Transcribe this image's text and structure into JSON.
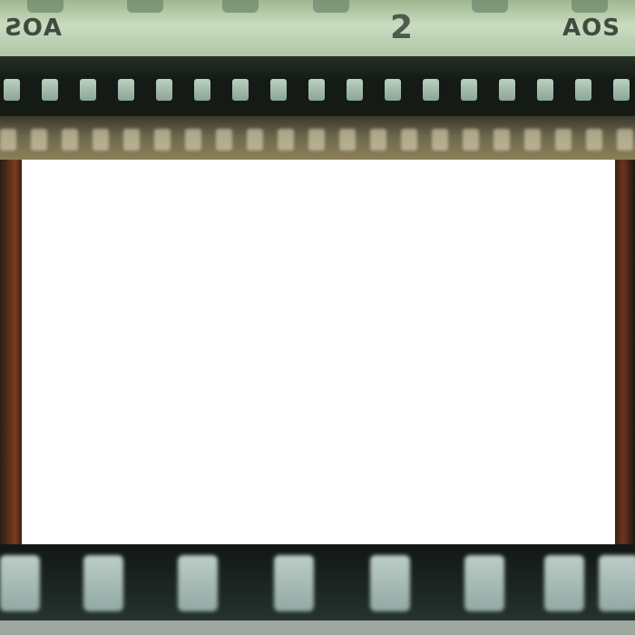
{
  "film": {
    "left_edge_code": "AOS",
    "right_edge_code": "AOS",
    "frame_number": "2"
  },
  "colors": {
    "blank_frame": "#ffffff",
    "sprocket_band": "#141a15",
    "top_strip": "#c9dcc0",
    "side_border": "#7c3c20"
  }
}
